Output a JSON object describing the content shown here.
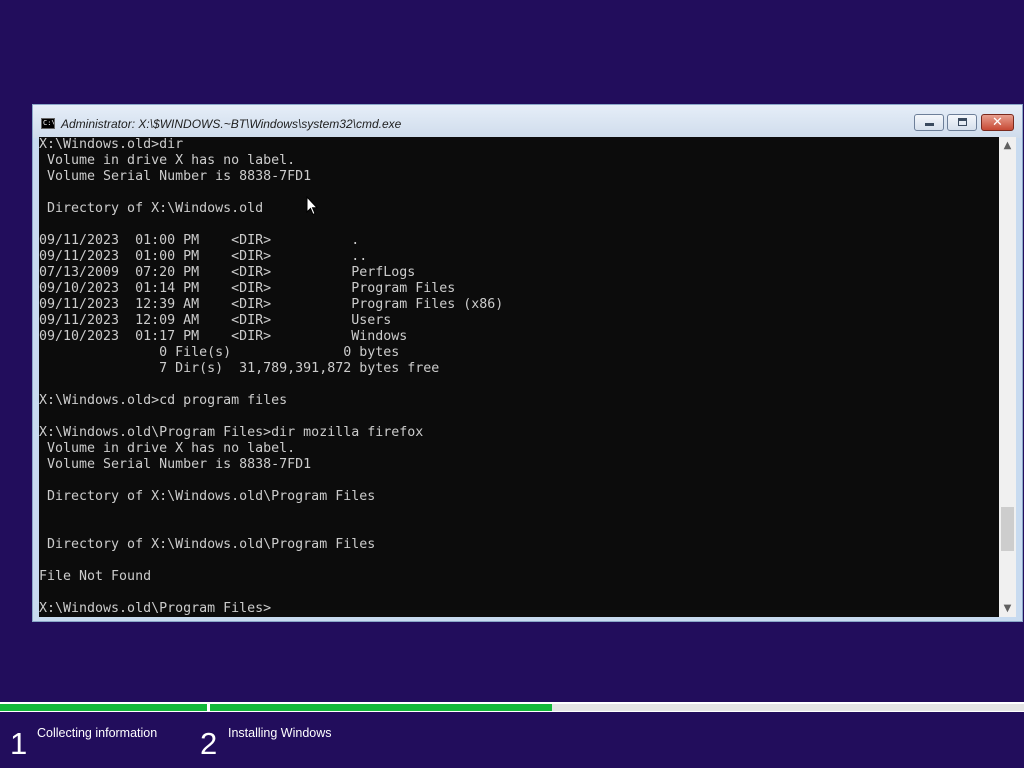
{
  "window": {
    "title": "Administrator: X:\\$WINDOWS.~BT\\Windows\\system32\\cmd.exe",
    "icon": "cmd-icon",
    "controls": {
      "minimize": "minimize-icon",
      "maximize": "maximize-icon",
      "close": "close-icon"
    }
  },
  "console": {
    "lines": [
      "X:\\Windows.old>dir",
      " Volume in drive X has no label.",
      " Volume Serial Number is 8838-7FD1",
      "",
      " Directory of X:\\Windows.old",
      "",
      "09/11/2023  01:00 PM    <DIR>          .",
      "09/11/2023  01:00 PM    <DIR>          ..",
      "07/13/2009  07:20 PM    <DIR>          PerfLogs",
      "09/10/2023  01:14 PM    <DIR>          Program Files",
      "09/11/2023  12:39 AM    <DIR>          Program Files (x86)",
      "09/11/2023  12:09 AM    <DIR>          Users",
      "09/10/2023  01:17 PM    <DIR>          Windows",
      "               0 File(s)              0 bytes",
      "               7 Dir(s)  31,789,391,872 bytes free",
      "",
      "X:\\Windows.old>cd program files",
      "",
      "X:\\Windows.old\\Program Files>dir mozilla firefox",
      " Volume in drive X has no label.",
      " Volume Serial Number is 8838-7FD1",
      "",
      " Directory of X:\\Windows.old\\Program Files",
      "",
      "",
      " Directory of X:\\Windows.old\\Program Files",
      "",
      "File Not Found",
      "",
      "X:\\Windows.old\\Program Files>"
    ],
    "colors": {
      "background": "#0c0c0c",
      "text": "#cccccc"
    }
  },
  "scrollbar": {
    "up_arrow": "▲",
    "down_arrow": "▼"
  },
  "setup": {
    "progress": {
      "step1_complete": 1.0,
      "step2_fraction": 0.42,
      "color": "#14b83a"
    },
    "steps": [
      {
        "number": "1",
        "label": "Collecting information"
      },
      {
        "number": "2",
        "label": "Installing Windows"
      }
    ],
    "background": "#220d5c"
  }
}
